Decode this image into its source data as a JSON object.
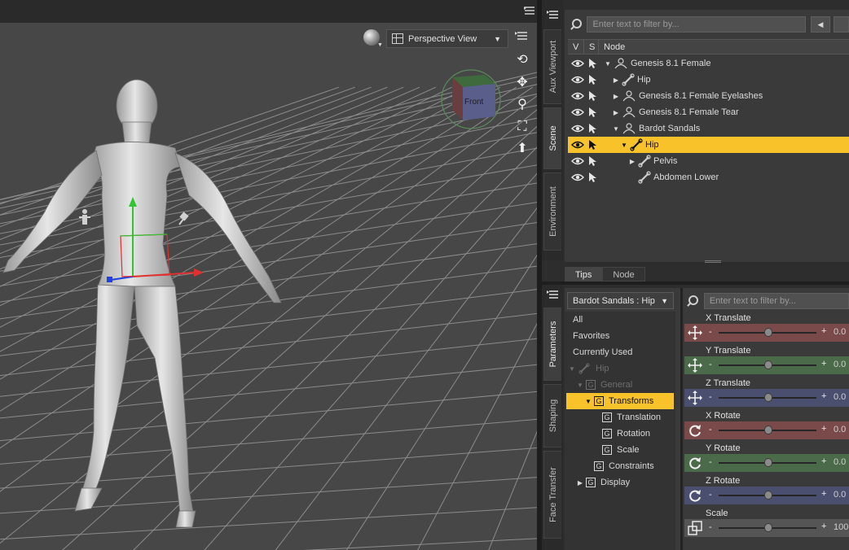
{
  "viewport": {
    "view_dropdown": "Perspective View",
    "cube_face": "Front",
    "tools": [
      "orbit-icon",
      "pan-icon",
      "zoom-icon",
      "frame-icon",
      "home-icon"
    ]
  },
  "dock_tabs_top": [
    "Aux Viewport",
    "Scene",
    "Environment"
  ],
  "dock_tabs_bottom": [
    "Parameters",
    "Shaping",
    "Face Transfer"
  ],
  "scene": {
    "filter_placeholder": "Enter text to filter by...",
    "columns": [
      "V",
      "S",
      "Node"
    ],
    "rows": [
      {
        "label": "Genesis 8.1 Female",
        "type": "figure",
        "expander": "▼",
        "depth": 0,
        "selected": false
      },
      {
        "label": "Hip",
        "type": "bone",
        "expander": "▶",
        "depth": 1,
        "selected": false
      },
      {
        "label": "Genesis 8.1 Female Eyelashes",
        "type": "figure",
        "expander": "▶",
        "depth": 1,
        "selected": false
      },
      {
        "label": "Genesis 8.1 Female Tear",
        "type": "figure",
        "expander": "▶",
        "depth": 1,
        "selected": false
      },
      {
        "label": "Bardot Sandals",
        "type": "figure",
        "expander": "▼",
        "depth": 1,
        "selected": false
      },
      {
        "label": "Hip",
        "type": "bone",
        "expander": "▼",
        "depth": 2,
        "selected": true
      },
      {
        "label": "Pelvis",
        "type": "bone",
        "expander": "▶",
        "depth": 3,
        "selected": false
      },
      {
        "label": "Abdomen Lower",
        "type": "bone",
        "expander": "",
        "depth": 3,
        "selected": false
      }
    ],
    "bottom_tabs": [
      "Tips",
      "Node"
    ]
  },
  "parameters": {
    "node_dropdown": "Bardot Sandals : Hip",
    "filter_placeholder": "Enter text to filter by...",
    "groups": [
      {
        "label": "All",
        "depth": 0,
        "icon": "none",
        "state": "normal",
        "expander": ""
      },
      {
        "label": "Favorites",
        "depth": 0,
        "icon": "none",
        "state": "normal",
        "expander": ""
      },
      {
        "label": "Currently Used",
        "depth": 0,
        "icon": "none",
        "state": "normal",
        "expander": ""
      },
      {
        "label": "Hip",
        "depth": 0,
        "icon": "bone",
        "state": "dim",
        "expander": "▼"
      },
      {
        "label": "General",
        "depth": 1,
        "icon": "G",
        "state": "dim",
        "expander": "▼"
      },
      {
        "label": "Transforms",
        "depth": 2,
        "icon": "G",
        "state": "selected",
        "expander": "▼"
      },
      {
        "label": "Translation",
        "depth": 3,
        "icon": "G",
        "state": "normal",
        "expander": ""
      },
      {
        "label": "Rotation",
        "depth": 3,
        "icon": "G",
        "state": "normal",
        "expander": ""
      },
      {
        "label": "Scale",
        "depth": 3,
        "icon": "G",
        "state": "normal",
        "expander": ""
      },
      {
        "label": "Constraints",
        "depth": 2,
        "icon": "G",
        "state": "normal",
        "expander": ""
      },
      {
        "label": "Display",
        "depth": 1,
        "icon": "G",
        "state": "normal",
        "expander": "▶"
      }
    ],
    "sliders": [
      {
        "label": "X Translate",
        "value": "0.0",
        "color": "#7a4a4a",
        "icon": "move-icon"
      },
      {
        "label": "Y Translate",
        "value": "0.0",
        "color": "#4a6a4a",
        "icon": "move-icon"
      },
      {
        "label": "Z Translate",
        "value": "0.0",
        "color": "#4a4f70",
        "icon": "move-icon"
      },
      {
        "label": "X Rotate",
        "value": "0.0",
        "color": "#7a4a4a",
        "icon": "rotate-icon"
      },
      {
        "label": "Y Rotate",
        "value": "0.0",
        "color": "#4a6a4a",
        "icon": "rotate-icon"
      },
      {
        "label": "Z Rotate",
        "value": "0.0",
        "color": "#4a4f70",
        "icon": "rotate-icon"
      },
      {
        "label": "Scale",
        "value": "100.",
        "color": "#555555",
        "icon": "scale-icon"
      }
    ]
  },
  "colors": {
    "selection": "#f7c22a",
    "viewport_bg": "#474747",
    "panel_bg": "#3a3a3a"
  }
}
